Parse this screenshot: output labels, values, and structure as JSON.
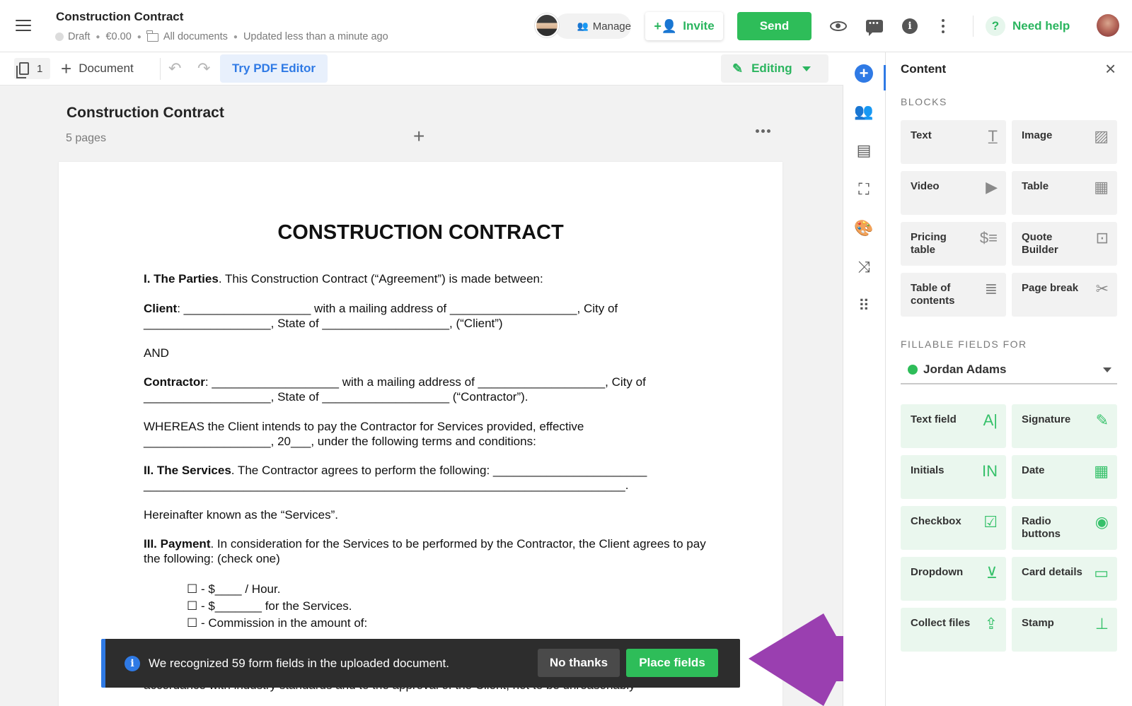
{
  "header": {
    "title": "Construction Contract",
    "status": "Draft",
    "price": "€0.00",
    "folder": "All documents",
    "updated": "Updated less than a minute ago",
    "manage_label": "Manage",
    "invite_label": "Invite",
    "send_label": "Send",
    "help_label": "Need help"
  },
  "toolbar": {
    "page_count": "1",
    "add_document_label": "Document",
    "try_pdf_label": "Try PDF Editor",
    "mode_label": "Editing"
  },
  "document": {
    "title": "Construction Contract",
    "pages": "5 pages",
    "heading": "CONSTRUCTION CONTRACT",
    "p1_bold": "I. The Parties",
    "p1_text": ". This Construction Contract (“Agreement”) is made between:",
    "p2_bold": "Client",
    "p2_text": ": ___________________ with a mailing address of ___________________, City of ___________________, State of ___________________, (“Client”)",
    "p3_text": "AND",
    "p4_bold": "Contractor",
    "p4_text": ": ___________________ with a mailing address of ___________________, City of ___________________, State of ___________________ (“Contractor”).",
    "p5_text": "WHEREAS the Client intends to pay the Contractor for Services provided, effective ___________________, 20___, under the following terms and conditions:",
    "p6_bold": "II. The Services",
    "p6_text": ". The Contractor agrees to perform the following: _______________________ ________________________________________________________________________.",
    "p7_text": "Hereinafter known as the “Services”.",
    "p8_bold": "III. Payment",
    "p8_text": ". In consideration for the Services to be performed by the Contractor, the Client agrees to pay the following: (check one)",
    "check1": "☐ - $____ / Hour.",
    "check2": "☐ - $_______ for the Services.",
    "check3": "☐ - Commission in the amount of:",
    "p9_text": "accordance with industry standards and to the approval of the Client, not to be unreasonably"
  },
  "notification": {
    "text": "We recognized 59 form fields in the uploaded document.",
    "dismiss_label": "No thanks",
    "accept_label": "Place fields"
  },
  "panel": {
    "title": "Content",
    "blocks_label": "BLOCKS",
    "blocks": [
      {
        "label": "Text",
        "icon": "text-block-icon",
        "glyph": "T̲"
      },
      {
        "label": "Image",
        "icon": "image-icon",
        "glyph": "▨"
      },
      {
        "label": "Video",
        "icon": "video-icon",
        "glyph": "▶"
      },
      {
        "label": "Table",
        "icon": "table-icon",
        "glyph": "▦"
      },
      {
        "label": "Pricing table",
        "icon": "pricing-table-icon",
        "glyph": "$≡"
      },
      {
        "label": "Quote Builder",
        "icon": "quote-builder-icon",
        "glyph": "⊡"
      },
      {
        "label": "Table of contents",
        "icon": "table-of-contents-icon",
        "glyph": "≣"
      },
      {
        "label": "Page break",
        "icon": "scissors-icon",
        "glyph": "✂"
      }
    ],
    "fields_label": "FILLABLE FIELDS FOR",
    "assignee": "Jordan Adams",
    "fields": [
      {
        "label": "Text field",
        "icon": "text-field-icon",
        "glyph": "A|"
      },
      {
        "label": "Signature",
        "icon": "signature-icon",
        "glyph": "✎"
      },
      {
        "label": "Initials",
        "icon": "initials-icon",
        "glyph": "IN"
      },
      {
        "label": "Date",
        "icon": "calendar-icon",
        "glyph": "▦"
      },
      {
        "label": "Checkbox",
        "icon": "checkbox-icon",
        "glyph": "☑"
      },
      {
        "label": "Radio buttons",
        "icon": "radio-icon",
        "glyph": "◉"
      },
      {
        "label": "Dropdown",
        "icon": "dropdown-icon",
        "glyph": "⊻"
      },
      {
        "label": "Card details",
        "icon": "card-icon",
        "glyph": "▭"
      },
      {
        "label": "Collect files",
        "icon": "upload-icon",
        "glyph": "⇪"
      },
      {
        "label": "Stamp",
        "icon": "stamp-icon",
        "glyph": "⊥"
      }
    ]
  },
  "colors": {
    "accent_green": "#2ebd59",
    "accent_blue": "#2f7ae5",
    "annotation_arrow": "#9a3fb0"
  }
}
